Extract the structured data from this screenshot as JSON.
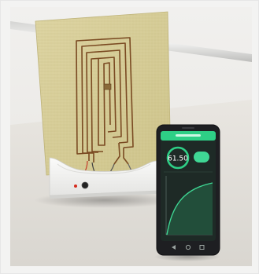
{
  "photo": {
    "phone_reading": "61.50",
    "colors": {
      "wall": "#ecebe8",
      "table": "#e4e1dc",
      "panel": "#d6cc94",
      "copper_trace": "#7a4a22",
      "base": "#f7f7f5",
      "phone_body": "#1e1f22",
      "screen": "#1e2a26",
      "app_accent": "#2ecf86"
    },
    "icons": [
      "phone-home-icon",
      "phone-back-icon",
      "phone-recent-icon",
      "base-button-icon",
      "base-led-icon"
    ]
  }
}
